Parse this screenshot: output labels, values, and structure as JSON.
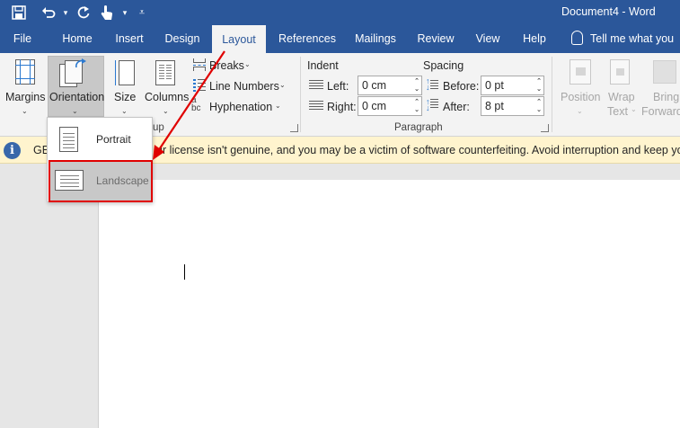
{
  "title_bar": {
    "document_title": "Document4  -  Word",
    "quick_access": [
      {
        "name": "save-icon",
        "glyph": "🖫"
      },
      {
        "name": "undo-icon",
        "glyph": "↶"
      },
      {
        "name": "undo-dropdown-icon",
        "glyph": "▾"
      },
      {
        "name": "redo-icon",
        "glyph": "↻"
      },
      {
        "name": "touch-mode-icon",
        "glyph": "☝"
      },
      {
        "name": "touch-dropdown-icon",
        "glyph": "▾"
      },
      {
        "name": "customize-qat-icon",
        "glyph": "⇟"
      }
    ]
  },
  "tabs": {
    "file": "File",
    "home": "Home",
    "insert": "Insert",
    "design": "Design",
    "layout": "Layout",
    "references": "References",
    "mailings": "Mailings",
    "review": "Review",
    "view": "View",
    "help": "Help",
    "tell_me": "Tell me what you"
  },
  "ribbon": {
    "margins": "Margins",
    "orientation": "Orientation",
    "size": "Size",
    "columns": "Columns",
    "breaks": "Breaks",
    "line_numbers": "Line Numbers",
    "hyphenation": "Hyphenation",
    "page_setup_tail": "up",
    "indent": {
      "title": "Indent",
      "left_label": "Left:",
      "left_value": "0 cm",
      "right_label": "Right:",
      "right_value": "0 cm"
    },
    "spacing": {
      "title": "Spacing",
      "before_label": "Before:",
      "before_value": "0 pt",
      "after_label": "After:",
      "after_value": "8 pt"
    },
    "paragraph_group": "Paragraph",
    "position_line1": "Position",
    "wrap_line1": "Wrap",
    "wrap_line2": "Text",
    "bring_line1": "Bring",
    "bring_line2": "Forward"
  },
  "infobar": {
    "prefix": "GET",
    "message": "ur license isn't genuine, and you may be a victim of software counterfeiting. Avoid interruption and keep your f"
  },
  "orientation_menu": {
    "portrait": "Portrait",
    "landscape": "Landscape"
  },
  "colors": {
    "title_blue": "#2b579a",
    "ribbon_bg": "#f3f3f3",
    "info_bg": "#fff4ce",
    "highlight_red": "#e00000"
  }
}
